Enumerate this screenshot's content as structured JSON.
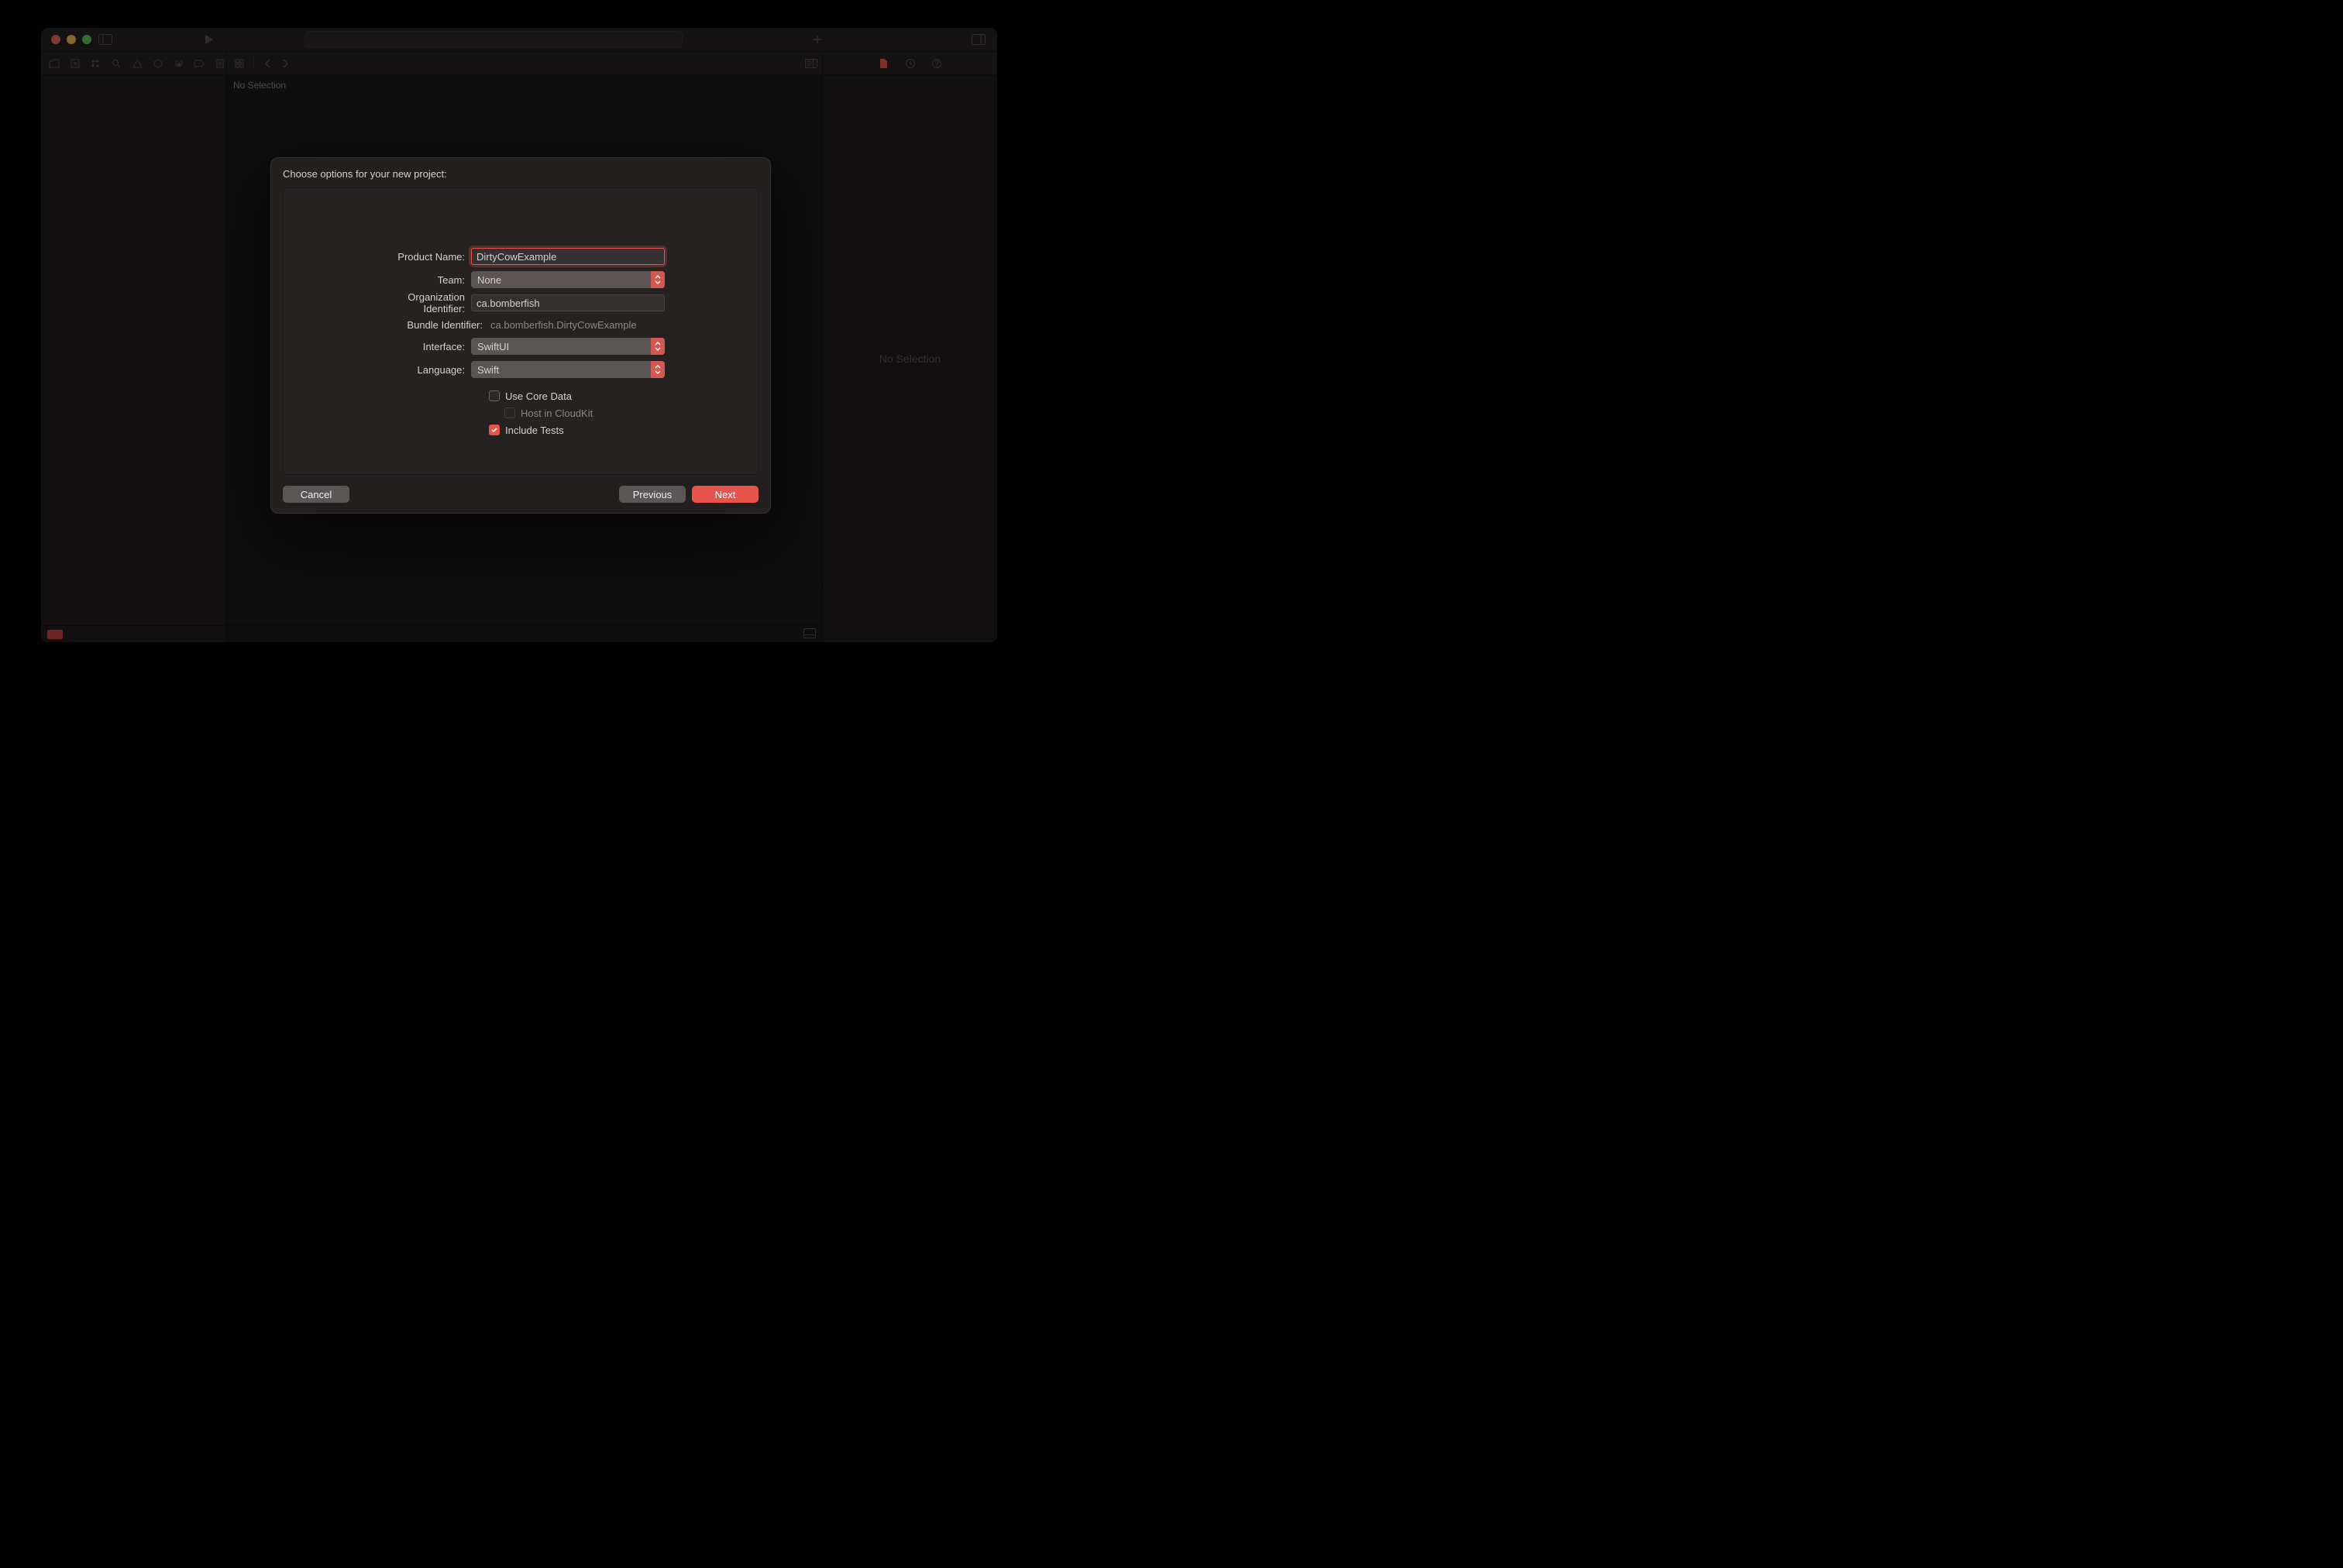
{
  "editor": {
    "crumb": "No Selection"
  },
  "inspector": {
    "empty": "No Selection"
  },
  "sheet": {
    "title": "Choose options for your new project:",
    "labels": {
      "product": "Product Name:",
      "team": "Team:",
      "org": "Organization Identifier:",
      "bundle": "Bundle Identifier:",
      "iface": "Interface:",
      "lang": "Language:"
    },
    "values": {
      "product": "DirtyCowExample",
      "team": "None",
      "org": "ca.bomberfish",
      "bundle": "ca.bomberfish.DirtyCowExample",
      "iface": "SwiftUI",
      "lang": "Swift"
    },
    "checks": {
      "coredata": "Use Core Data",
      "cloudkit": "Host in CloudKit",
      "tests": "Include Tests"
    },
    "buttons": {
      "cancel": "Cancel",
      "prev": "Previous",
      "next": "Next"
    }
  }
}
